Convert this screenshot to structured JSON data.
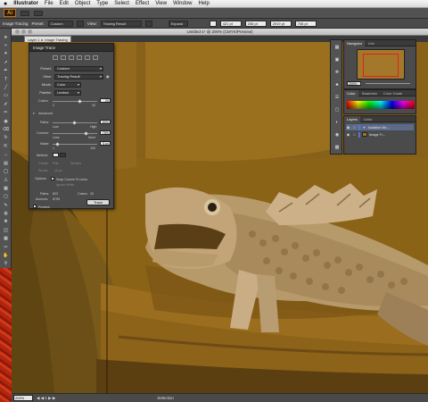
{
  "menubar": {
    "apple": "",
    "items": [
      "Illustrator",
      "File",
      "Edit",
      "Object",
      "Type",
      "Select",
      "Effect",
      "View",
      "Window",
      "Help"
    ]
  },
  "appbar": {
    "logo": "Ai"
  },
  "control_bar": {
    "mode_label": "Image Tracing",
    "preset_label": "Preset:",
    "preset_value": "Custom",
    "view_label": "View:",
    "view_value": "Tracing Result",
    "expand_label": "Expand",
    "x_value": "421 pt",
    "y_value": "258 pt",
    "w_value": "2919 pt",
    "h_value": "708 pt"
  },
  "document": {
    "title": "Untitled-1* @ 200% (CMYK/Preview)",
    "tab_label": "Layer 1",
    "tab_object": "Image Tracing",
    "zoom": "200%",
    "status_tool": "Selection"
  },
  "image_trace": {
    "title": "Image Trace",
    "preset_label": "Preset:",
    "preset_value": "Custom",
    "view_label": "View:",
    "view_value": "Tracing Result",
    "mode_label": "Mode:",
    "mode_value": "Color",
    "palette_label": "Palette:",
    "palette_value": "Limited",
    "colors_label": "Colors:",
    "colors_value": "20",
    "colors_min": "2",
    "colors_max": "30",
    "advanced_label": "Advanced",
    "paths_label": "Paths:",
    "paths_value": "50%",
    "low_label": "Low",
    "high_label": "High",
    "corners_label": "Corners:",
    "corners_value": "75%",
    "less_label": "Less",
    "more_label": "More",
    "noise_label": "Noise:",
    "noise_value": "5 px",
    "noise_min": "1",
    "noise_max": "100",
    "method_label": "Method:",
    "create_label": "Create:",
    "fills_label": "Fills",
    "strokes_label": "Strokes",
    "stroke_label": "Stroke:",
    "stroke_value": "10 px",
    "options_label": "Options:",
    "snap_label": "Snap Curves To Lines",
    "ignore_white_label": "Ignore White",
    "paths_count_label": "Paths:",
    "paths_count": "823",
    "colors_count_label": "Colors:",
    "colors_count": "20",
    "anchors_label": "Anchors:",
    "anchors_count": "8799",
    "preview_label": "Preview",
    "trace_button": "Trace"
  },
  "navigator": {
    "tabs": [
      "Navigator",
      "Info"
    ],
    "zoom": "200%"
  },
  "color_panel": {
    "tabs": [
      "Color",
      "Swatches",
      "Color Guide"
    ]
  },
  "layers_panel": {
    "tabs": [
      "Layers",
      "Links"
    ],
    "rows": [
      {
        "name": "Isolation Mo..."
      },
      {
        "name": "Image Tr..."
      }
    ]
  },
  "icons": {
    "tool_icons": [
      "selection-tool-icon",
      "direct-selection-tool-icon",
      "magic-wand-tool-icon",
      "lasso-tool-icon",
      "pen-tool-icon",
      "type-tool-icon",
      "line-tool-icon",
      "rectangle-tool-icon",
      "paintbrush-tool-icon",
      "pencil-tool-icon",
      "blob-brush-tool-icon",
      "eraser-tool-icon",
      "rotate-tool-icon",
      "scale-tool-icon",
      "width-tool-icon",
      "free-transform-tool-icon",
      "shape-builder-tool-icon",
      "perspective-grid-tool-icon",
      "mesh-tool-icon",
      "gradient-tool-icon",
      "eyedropper-tool-icon",
      "blend-tool-icon",
      "symbol-sprayer-tool-icon",
      "column-graph-tool-icon",
      "artboard-tool-icon",
      "slice-tool-icon",
      "hand-tool-icon",
      "zoom-tool-icon"
    ]
  }
}
